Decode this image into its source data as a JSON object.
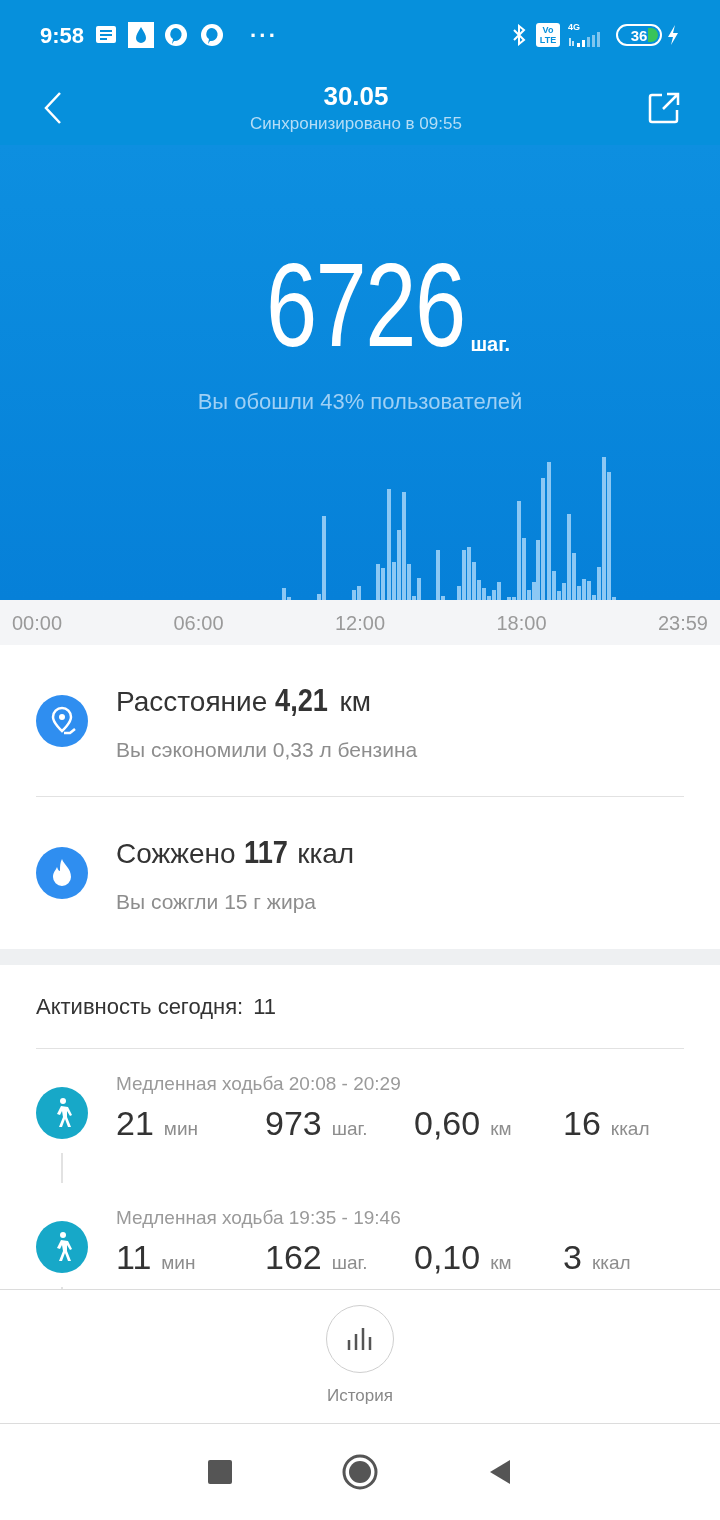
{
  "status_bar": {
    "time": "9:58",
    "more": "···",
    "volte": [
      "Vo",
      "LTE"
    ],
    "network": "4G",
    "battery": "36"
  },
  "header": {
    "date": "30.05",
    "sync": "Синхронизировано в 09:55"
  },
  "steps": {
    "value": "6726",
    "unit": "шаг.",
    "comparison": "Вы обошли 43% пользователей"
  },
  "chart_axis": [
    "00:00",
    "06:00",
    "12:00",
    "18:00",
    "23:59"
  ],
  "stats": [
    {
      "kind": "distance",
      "label": "Расстояние",
      "value": "4,21",
      "unit": "км",
      "note": "Вы сэкономили 0,33 л бензина"
    },
    {
      "kind": "calories",
      "label": "Сожжено",
      "value": "117",
      "unit": "ккал",
      "note": "Вы сожгли 15 г жира"
    }
  ],
  "activity": {
    "title": "Активность сегодня:",
    "count": "11",
    "items": [
      {
        "kind": "walk",
        "title": "Медленная ходьба 20:08 - 20:29",
        "stats": [
          {
            "value": "21",
            "unit": "мин"
          },
          {
            "value": "973",
            "unit": "шаг."
          },
          {
            "value": "0,60",
            "unit": "км"
          },
          {
            "value": "16",
            "unit": "ккал"
          }
        ]
      },
      {
        "kind": "walk",
        "title": "Медленная ходьба 19:35 - 19:46",
        "stats": [
          {
            "value": "11",
            "unit": "мин"
          },
          {
            "value": "162",
            "unit": "шаг."
          },
          {
            "value": "0,10",
            "unit": "км"
          },
          {
            "value": "3",
            "unit": "ккал"
          }
        ]
      }
    ]
  },
  "bottom": {
    "history": "История"
  }
}
